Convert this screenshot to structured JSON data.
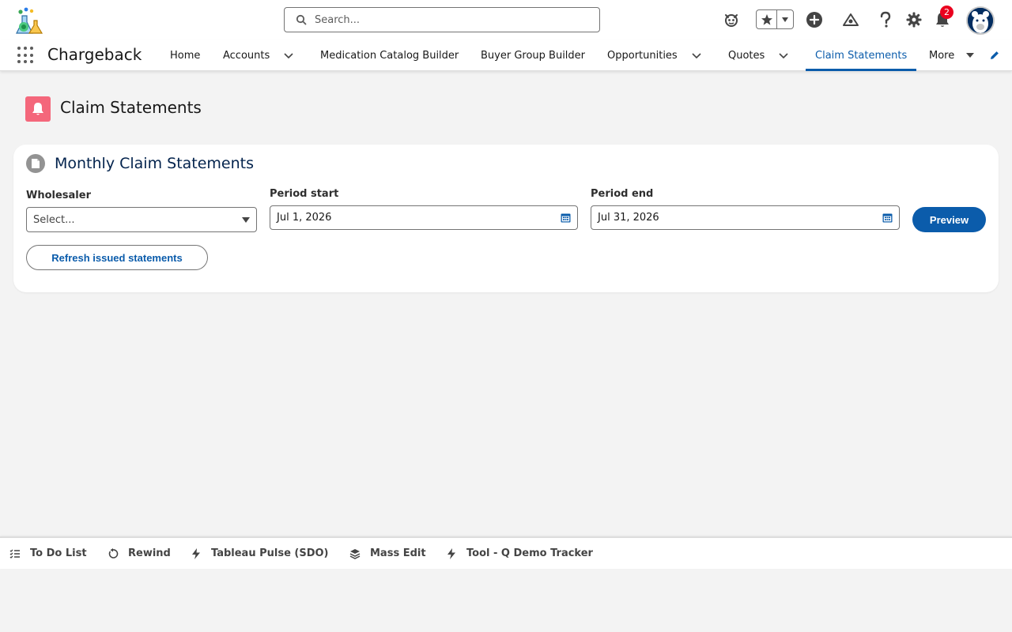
{
  "header": {
    "search_placeholder": "Search...",
    "notification_count": "2"
  },
  "nav": {
    "app_name": "Chargeback",
    "items": [
      {
        "label": "Home"
      },
      {
        "label": "Accounts"
      },
      {
        "label": "Medication Catalog Builder"
      },
      {
        "label": "Buyer Group Builder"
      },
      {
        "label": "Opportunities"
      },
      {
        "label": "Quotes"
      },
      {
        "label": "Claim Statements"
      },
      {
        "label": "More"
      }
    ],
    "active_item": "Claim Statements"
  },
  "page": {
    "title": "Claim Statements"
  },
  "card": {
    "title": "Monthly Claim Statements",
    "wholesaler_label": "Wholesaler",
    "wholesaler_placeholder": "Select...",
    "period_start_label": "Period start",
    "period_start_value": "Jul 1, 2026",
    "period_end_label": "Period end",
    "period_end_value": "Jul 31, 2026",
    "preview_label": "Preview",
    "refresh_label": "Refresh issued statements"
  },
  "utility_bar": {
    "items": [
      {
        "label": "To Do List",
        "icon": "checklist-icon"
      },
      {
        "label": "Rewind",
        "icon": "rewind-icon"
      },
      {
        "label": "Tableau Pulse (SDO)",
        "icon": "lightning-icon"
      },
      {
        "label": "Mass Edit",
        "icon": "layers-icon"
      },
      {
        "label": "Tool - Q Demo Tracker",
        "icon": "lightning-icon"
      }
    ]
  },
  "colors": {
    "brand": "#0b5cab",
    "page_icon": "#f4677b",
    "badge": "#ea001e"
  }
}
